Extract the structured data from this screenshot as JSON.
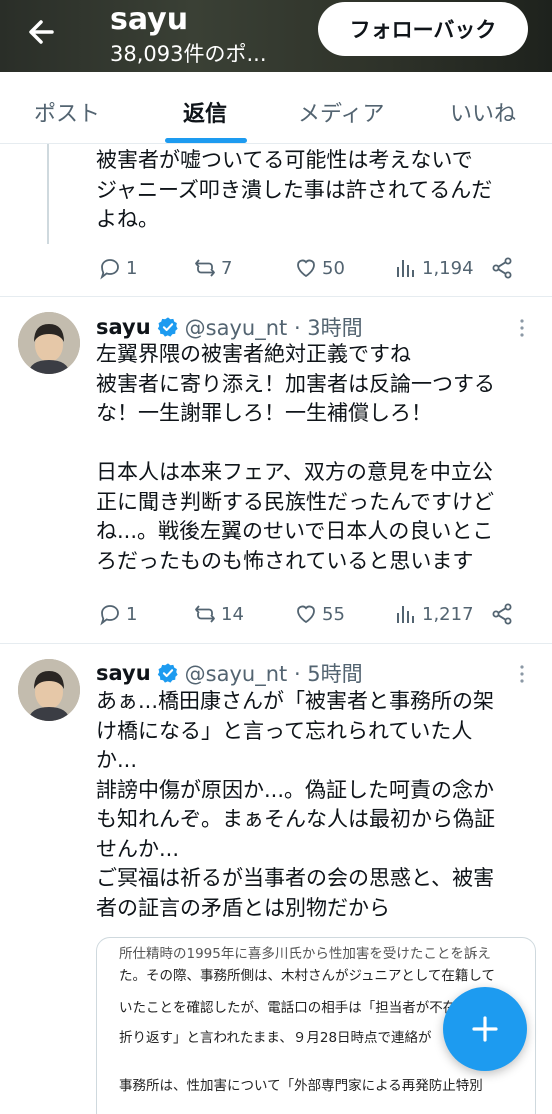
{
  "header": {
    "name": "sayu",
    "post_count": "38,093件のポ...",
    "follow_back_label": "フォローバック"
  },
  "tabs": [
    {
      "label": "ポスト",
      "active": false
    },
    {
      "label": "返信",
      "active": true
    },
    {
      "label": "メディア",
      "active": false
    },
    {
      "label": "いいね",
      "active": false
    }
  ],
  "tweets": [
    {
      "text_lines": [
        "被害者が嘘ついてる可能性は考えないで",
        "ジャニーズ叩き潰した事は許されてるんだ",
        "よね。"
      ],
      "replies": "1",
      "reposts": "7",
      "likes": "50",
      "views": "1,194"
    },
    {
      "name": "sayu",
      "handle_time": "@sayu_nt · 3時間",
      "text_lines": [
        "左翼界隈の被害者絶対正義ですね",
        "被害者に寄り添え！加害者は反論一つする",
        "な！一生謝罪しろ！一生補償しろ！",
        "",
        "日本人は本来フェア、双方の意見を中立公",
        "正に聞き判断する民族性だったんですけど",
        "ね...。戦後左翼のせいで日本人の良いとこ",
        "ろだったものも怖されていると思います"
      ],
      "replies": "1",
      "reposts": "14",
      "likes": "55",
      "views": "1,217"
    },
    {
      "name": "sayu",
      "handle_time": "@sayu_nt · 5時間",
      "text_lines": [
        "あぁ...橋田康さんが「被害者と事務所の架",
        "け橋になる」と言って忘れられていた人",
        "か...",
        "誹謗中傷が原因か...。偽証した呵責の念か",
        "も知れんぞ。まぁそんな人は最初から偽証",
        "せんか...",
        "ご冥福は祈るが当事者の会の思惑と、被害",
        "者の証言の矛盾とは別物だから"
      ],
      "embed_lines": [
        "所仕精時の1995年に喜多川氏から性加害を受けたことを訴え",
        "た。その際、事務所側は、木村さんがジュニアとして在籍して",
        "いたことを確認したが、電話口の相手は「担当者が不在",
        "折り返す」と言われたまま、９月28日時点で連絡が",
        "事務所は、性加害について「外部専門家による再発防止特別"
      ]
    }
  ],
  "colors": {
    "accent": "#1d9bf0",
    "text": "#0f1419",
    "muted": "#536471"
  }
}
